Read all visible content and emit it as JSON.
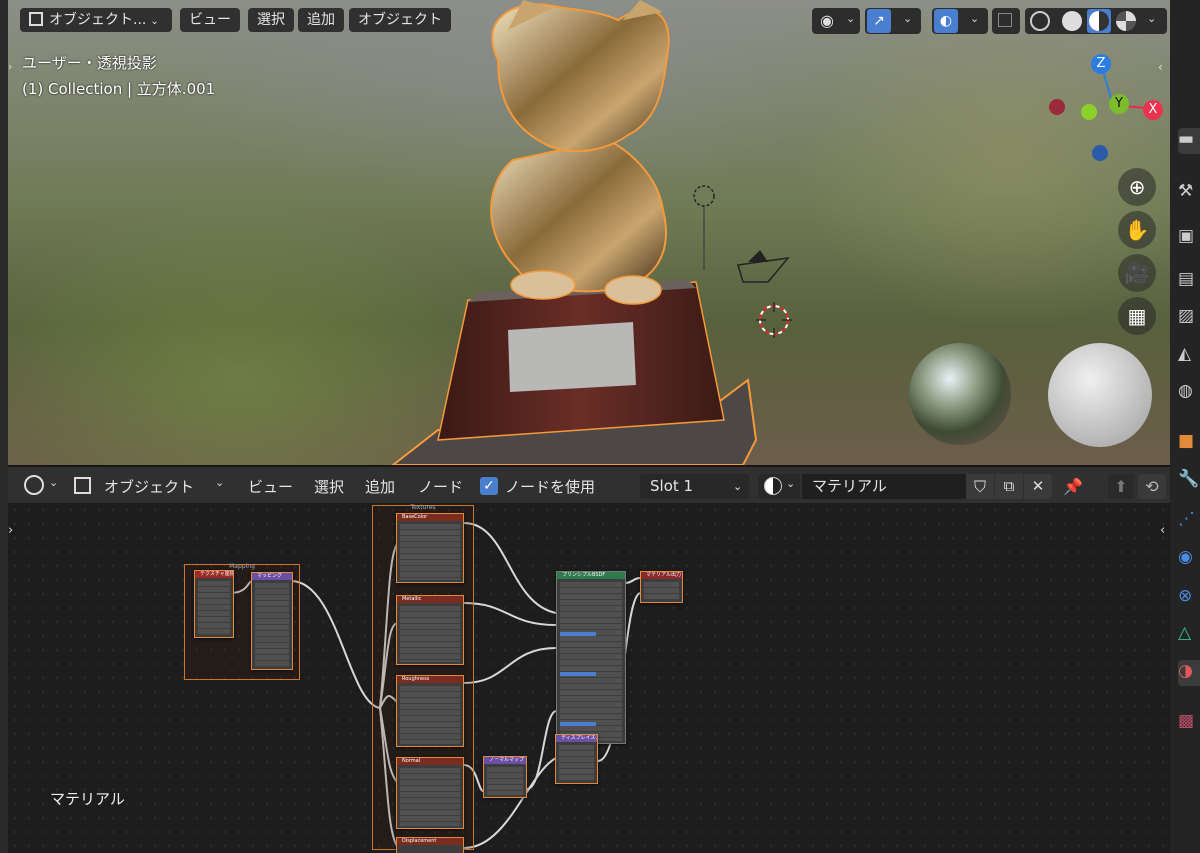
{
  "viewport": {
    "mode_label": "オブジェクト...",
    "menu": [
      "ビュー",
      "選択",
      "追加",
      "オブジェクト"
    ],
    "view_name": "ユーザー・透視投影",
    "collection_info": "(1) Collection | 立方体.001",
    "gizmo": {
      "z": "Z",
      "y": "Y",
      "x": "X"
    },
    "nav_icons": [
      "zoom-icon",
      "hand-pan-icon",
      "camera-icon",
      "grid-ortho-icon"
    ]
  },
  "node_header": {
    "mode_label": "オブジェクト",
    "menu": [
      "ビュー",
      "選択",
      "追加",
      "ノード"
    ],
    "use_nodes_label": "ノードを使用",
    "use_nodes_checked": true,
    "slot": "Slot 1",
    "material_name": "マテリアル"
  },
  "node_canvas": {
    "frame_textures_label": "Textures",
    "frame_mapping_label": "Mapping",
    "material_label": "マテリアル",
    "nodes": {
      "tex_coord": "テクスチャ座標",
      "mapping": "マッピング",
      "tex1": "BaseColor",
      "tex2": "Metallic",
      "tex3": "Roughness",
      "tex4": "Normal",
      "tex5": "Displacement",
      "normal_map": "ノーマルマップ",
      "bsdf": "プリンシプルBSDF",
      "output": "マテリアル出力",
      "displacement": "ディスプレイスメント"
    }
  },
  "colors": {
    "accent_blue": "#4a7fd0",
    "selection_orange": "#e08a3a"
  }
}
